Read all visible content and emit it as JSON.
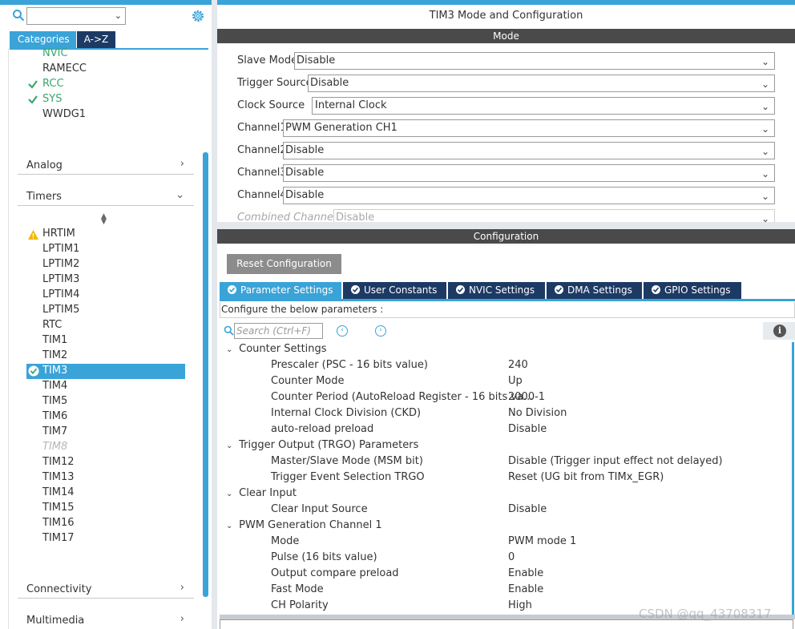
{
  "left": {
    "tabs": {
      "categories": "Categories",
      "az": "A->Z"
    },
    "system_items": [
      {
        "label": "NVIC",
        "status": "ok-partial"
      },
      {
        "label": "RAMECC",
        "status": "none"
      },
      {
        "label": "RCC",
        "status": "ok"
      },
      {
        "label": "SYS",
        "status": "ok"
      },
      {
        "label": "WWDG1",
        "status": "none"
      }
    ],
    "sections": {
      "analog": "Analog",
      "timers": "Timers",
      "connectivity": "Connectivity",
      "multimedia": "Multimedia"
    },
    "timer_items": [
      "HRTIM",
      "LPTIM1",
      "LPTIM2",
      "LPTIM3",
      "LPTIM4",
      "LPTIM5",
      "RTC",
      "TIM1",
      "TIM2",
      "TIM3",
      "TIM4",
      "TIM5",
      "TIM6",
      "TIM7",
      "TIM8",
      "TIM12",
      "TIM13",
      "TIM14",
      "TIM15",
      "TIM16",
      "TIM17"
    ],
    "selected_timer": "TIM3",
    "disabled_timer": "TIM8",
    "warning_timer": "HRTIM"
  },
  "right": {
    "title": "TIM3 Mode and Configuration",
    "mode_header": "Mode",
    "mode_rows": [
      {
        "label": "Slave Mode",
        "value": "Disable"
      },
      {
        "label": "Trigger Source",
        "value": "Disable"
      },
      {
        "label": "Clock Source",
        "value": "Internal Clock"
      },
      {
        "label": "Channel1",
        "value": "PWM Generation CH1"
      },
      {
        "label": "Channel2",
        "value": "Disable"
      },
      {
        "label": "Channel3",
        "value": "Disable"
      },
      {
        "label": "Channel4",
        "value": "Disable"
      },
      {
        "label": "Combined Channels",
        "value": "Disable"
      }
    ],
    "config_header": "Configuration",
    "reset_button": "Reset Configuration",
    "tabs": [
      "Parameter Settings",
      "User Constants",
      "NVIC Settings",
      "DMA Settings",
      "GPIO Settings"
    ],
    "active_tab": "Parameter Settings",
    "caption": "Configure the below parameters :",
    "search_placeholder": "Search (Ctrl+F)",
    "groups": [
      {
        "name": "Counter Settings",
        "params": [
          {
            "name": "Prescaler (PSC - 16 bits value)",
            "value": "240"
          },
          {
            "name": "Counter Mode",
            "value": "Up"
          },
          {
            "name": "Counter Period (AutoReload Register - 16 bits va...",
            "value": "2000-1"
          },
          {
            "name": "Internal Clock Division (CKD)",
            "value": "No Division"
          },
          {
            "name": "auto-reload preload",
            "value": "Disable"
          }
        ]
      },
      {
        "name": "Trigger Output (TRGO) Parameters",
        "params": [
          {
            "name": "Master/Slave Mode (MSM bit)",
            "value": "Disable (Trigger input effect not delayed)"
          },
          {
            "name": "Trigger Event Selection TRGO",
            "value": "Reset (UG bit from TIMx_EGR)"
          }
        ]
      },
      {
        "name": "Clear Input",
        "params": [
          {
            "name": "Clear Input Source",
            "value": "Disable"
          }
        ]
      },
      {
        "name": "PWM Generation Channel 1",
        "params": [
          {
            "name": "Mode",
            "value": "PWM mode 1"
          },
          {
            "name": "Pulse (16 bits value)",
            "value": "0"
          },
          {
            "name": "Output compare preload",
            "value": "Enable"
          },
          {
            "name": "Fast Mode",
            "value": "Enable"
          },
          {
            "name": "CH Polarity",
            "value": "High"
          }
        ]
      }
    ]
  },
  "watermark": "CSDN @qq_43708317",
  "colors": {
    "accent": "#3aa3d8",
    "dark_tab": "#1d3a64",
    "header_bar": "#4a4a4a",
    "ok_green": "#3aa76d"
  }
}
